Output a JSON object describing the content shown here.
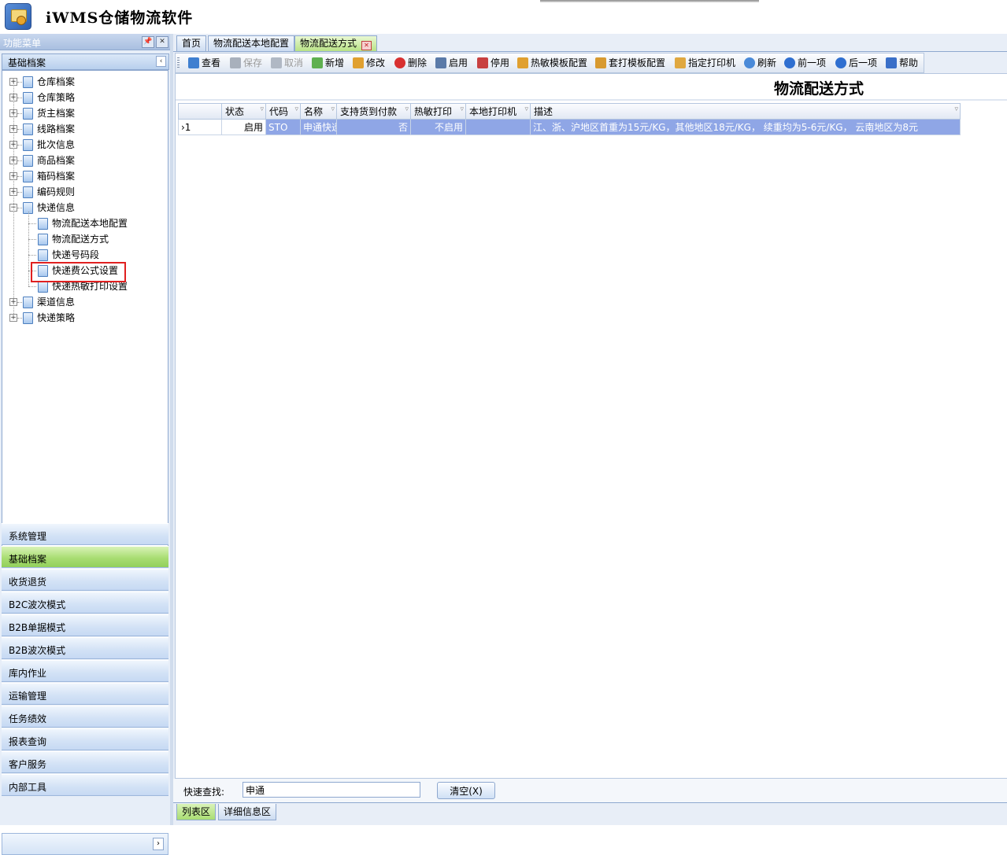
{
  "app": {
    "title": "iWMS仓储物流软件"
  },
  "left_panel": {
    "header": "功能菜单",
    "pin_glyph": "📌",
    "close_glyph": "✕",
    "section": "基础档案",
    "collapse_glyph": "‹",
    "tree": [
      {
        "label": "仓库档案",
        "expanded": false
      },
      {
        "label": "仓库策略",
        "expanded": false
      },
      {
        "label": "货主档案",
        "expanded": false
      },
      {
        "label": "线路档案",
        "expanded": false
      },
      {
        "label": "批次信息",
        "expanded": false
      },
      {
        "label": "商品档案",
        "expanded": false
      },
      {
        "label": "箱码档案",
        "expanded": false
      },
      {
        "label": "编码规则",
        "expanded": false
      },
      {
        "label": "快递信息",
        "expanded": true,
        "children": [
          "物流配送本地配置",
          "物流配送方式",
          "快递号码段",
          "快递费公式设置",
          "快递热敏打印设置"
        ]
      },
      {
        "label": "渠道信息",
        "expanded": false
      },
      {
        "label": "快递策略",
        "expanded": false
      }
    ],
    "nav": [
      "系统管理",
      "基础档案",
      "收货退货",
      "B2C波次模式",
      "B2B单据模式",
      "B2B波次模式",
      "库内作业",
      "运输管理",
      "任务绩效",
      "报表查询",
      "客户服务",
      "内部工具"
    ],
    "nav_active": "基础档案",
    "nav_scroll_glyph": "›"
  },
  "tabs": [
    {
      "label": "首页",
      "active": false
    },
    {
      "label": "物流配送本地配置",
      "active": false
    },
    {
      "label": "物流配送方式",
      "active": true,
      "close_glyph": "✕"
    }
  ],
  "toolbar": [
    {
      "label": "查看",
      "icon": "view-icon",
      "color": "#3f7fd0",
      "enabled": true
    },
    {
      "label": "保存",
      "icon": "save-icon",
      "color": "#a8b0bc",
      "enabled": false
    },
    {
      "label": "取消",
      "icon": "undo-icon",
      "color": "#b0b8c4",
      "enabled": false
    },
    {
      "label": "新增",
      "icon": "add-icon",
      "color": "#5fb050",
      "enabled": true
    },
    {
      "label": "修改",
      "icon": "edit-icon",
      "color": "#e0a030",
      "enabled": true
    },
    {
      "label": "删除",
      "icon": "delete-icon",
      "color": "#d83030",
      "enabled": true
    },
    {
      "label": "启用",
      "icon": "enable-icon",
      "color": "#5a7aa8",
      "enabled": true
    },
    {
      "label": "停用",
      "icon": "disable-icon",
      "color": "#c84040",
      "enabled": true
    },
    {
      "label": "热敏模板配置",
      "icon": "thermal-template-icon",
      "color": "#e0a030",
      "enabled": true
    },
    {
      "label": "套打模板配置",
      "icon": "overprint-template-icon",
      "color": "#d89a30",
      "enabled": true
    },
    {
      "label": "指定打印机",
      "icon": "printer-icon",
      "color": "#e0a840",
      "enabled": true
    },
    {
      "label": "刷新",
      "icon": "refresh-icon",
      "color": "#4a8ad8",
      "enabled": true
    },
    {
      "label": "前一项",
      "icon": "previous-icon",
      "color": "#2f6fd0",
      "enabled": true
    },
    {
      "label": "后一项",
      "icon": "next-icon",
      "color": "#2f6fd0",
      "enabled": true
    },
    {
      "label": "帮助",
      "icon": "help-icon",
      "color": "#3a6fc8",
      "enabled": true
    }
  ],
  "page": {
    "title": "物流配送方式"
  },
  "grid": {
    "filter_glyph": "▿",
    "columns": [
      "状态",
      "代码",
      "名称",
      "支持货到付款",
      "热敏打印",
      "本地打印机",
      "描述"
    ],
    "rows": [
      {
        "indicator": "›1",
        "状态": "启用",
        "代码": "STO",
        "名称": "申通快递",
        "支持货到付款": "否",
        "热敏打印": "不启用",
        "本地打印机": "",
        "描述": "江、浙、沪地区首重为15元/KG，其他地区18元/KG， 续重均为5-6元/KG， 云南地区为8元"
      }
    ]
  },
  "search": {
    "label": "快速查找:",
    "value": "申通",
    "clear_label": "清空(X)"
  },
  "bottom_tabs": [
    {
      "label": "列表区",
      "active": true
    },
    {
      "label": "详细信息区",
      "active": false
    }
  ]
}
